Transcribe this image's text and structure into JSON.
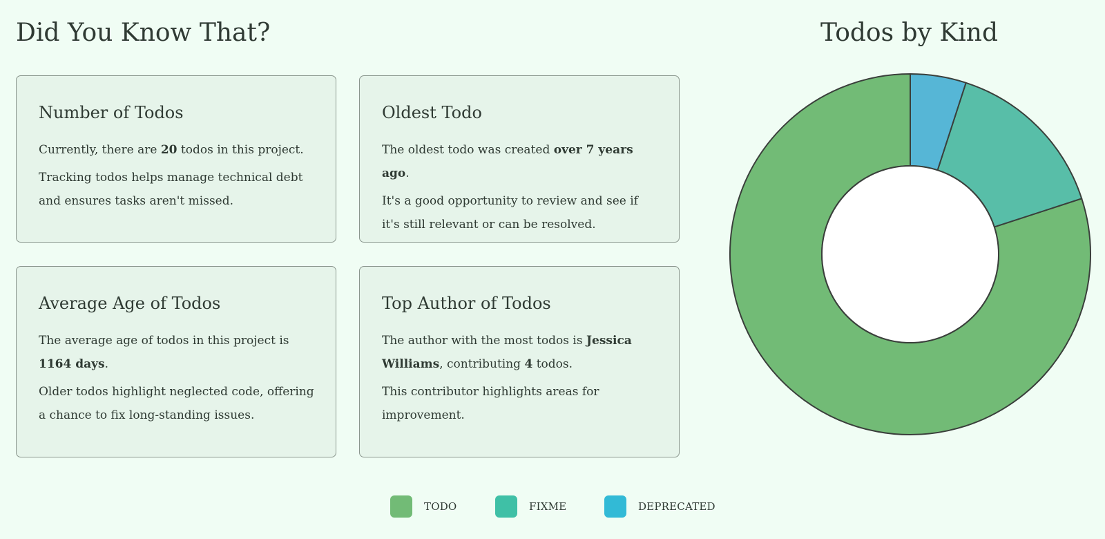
{
  "section_title": "Did You Know That?",
  "cards": {
    "count": {
      "title": "Number of Todos",
      "line1_pre": "Currently, there are ",
      "line1_value": "20",
      "line1_post": " todos in this project.",
      "line2": "Tracking todos helps manage technical debt and ensures tasks aren't missed."
    },
    "oldest": {
      "title": "Oldest Todo",
      "line1_pre": "The oldest todo was created ",
      "line1_value": "over 7 years ago",
      "line1_post": ".",
      "line2": "It's a good opportunity to review and see if it's still relevant or can be resolved."
    },
    "average": {
      "title": "Average Age of Todos",
      "line1_pre": "The average age of todos in this project is ",
      "line1_value": "1164 days",
      "line1_post": ".",
      "line2": "Older todos highlight neglected code, offering a chance to fix long-standing issues."
    },
    "author": {
      "title": "Top Author of Todos",
      "line1_pre": "The author with the most todos is ",
      "line1_value": "Jessica Williams",
      "line1_mid": ", contributing ",
      "line1_count": "4",
      "line1_post": " todos.",
      "line2": "This contributor highlights areas for improvement."
    }
  },
  "chart_data": {
    "type": "pie",
    "title": "Todos by Kind",
    "donut": true,
    "categories": [
      "TODO",
      "FIXME",
      "DEPRECATED"
    ],
    "values": [
      16,
      3,
      1
    ],
    "colors": [
      "#72bb76",
      "#58bea8",
      "#56b6d6"
    ],
    "legend_colors": [
      "#72bb76",
      "#3fc0a6",
      "#32bad6"
    ],
    "legend_position": "bottom"
  }
}
